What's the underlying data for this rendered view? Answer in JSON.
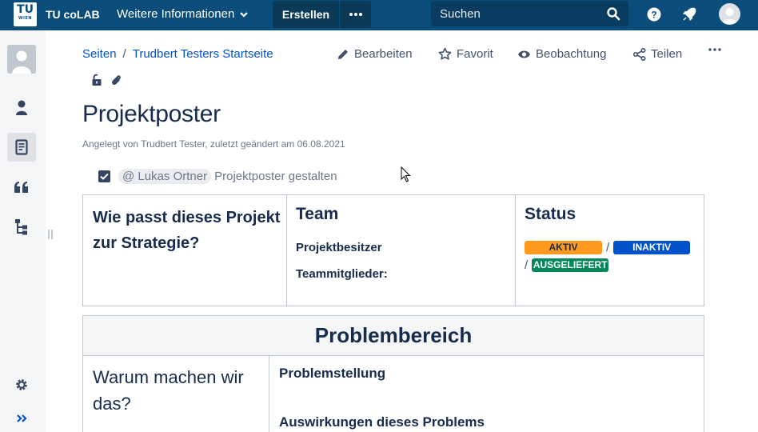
{
  "topbar": {
    "logo_text": "TU",
    "logo_sub": "WIEN",
    "app_name": "TU coLAB",
    "more_info": "Weitere Informationen",
    "create": "Erstellen",
    "search_placeholder": "Suchen"
  },
  "breadcrumb": {
    "items": [
      "Seiten",
      "Trudbert Testers Startseite"
    ],
    "separator": "/"
  },
  "page_actions": {
    "edit": "Bearbeiten",
    "favorite": "Favorit",
    "watch": "Beobachtung",
    "share": "Teilen"
  },
  "page": {
    "title": "Projektposter",
    "byline": "Angelegt von Trudbert Tester, zuletzt geändert am 06.08.2021",
    "task": {
      "mention": "@ Lukas Ortner",
      "text": "Projektposter gestalten",
      "checked": true
    }
  },
  "overview_table": {
    "strategy_heading": "Wie passt dieses Projekt zur Strategie?",
    "team_heading": "Team",
    "owner_label": "Projektbesitzer",
    "members_label": "Teammitglieder:",
    "status_heading": "Status",
    "status_separator": "/",
    "statuses": [
      {
        "label": "AKTIV",
        "color": "#ff991f"
      },
      {
        "label": "INAKTIV",
        "color": "#0052cc"
      },
      {
        "label": "AUSGELIEFERT",
        "color": "#00875a"
      }
    ]
  },
  "problem_table": {
    "heading": "Problembereich",
    "why": "Warum machen wir das?",
    "problem_statement": "Problemstellung",
    "impact": "Auswirkungen dieses Problems"
  },
  "colors": {
    "topbar": "#0a4d7a",
    "link": "#0052cc",
    "text": "#172b4d"
  }
}
